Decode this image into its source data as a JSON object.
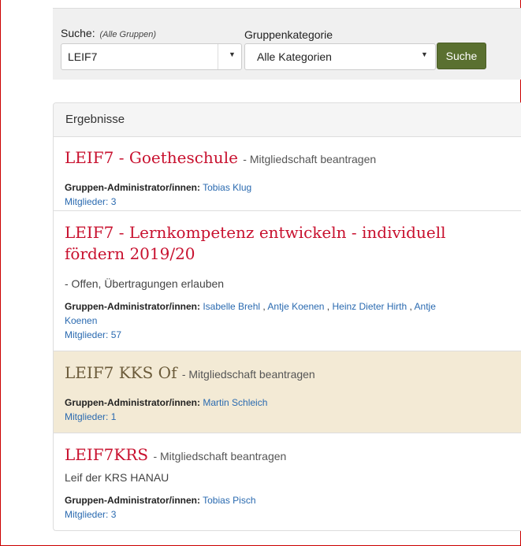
{
  "search": {
    "label": "Suche:",
    "hint": "(Alle Gruppen)",
    "value": "LEIF7",
    "category_label": "Gruppenkategorie",
    "category_value": "Alle Kategorien",
    "button": "Suche"
  },
  "results": {
    "heading": "Ergebnisse",
    "admin_label": "Gruppen-Administrator/innen:",
    "items": [
      {
        "title": "LEIF7 - Goetheschule",
        "meta": "- Mitgliedschaft beantragen",
        "admins": [
          "Tobias Klug"
        ],
        "members": "Mitglieder: 3"
      },
      {
        "title": "LEIF7 - Lernkompetenz entwickeln - individuell fördern 2019/20",
        "meta": "- Offen, Übertragungen erlauben",
        "admins": [
          "Isabelle Brehl",
          "Antje Koenen",
          "Heinz Dieter Hirth",
          "Antje Koenen"
        ],
        "members": "Mitglieder: 57"
      },
      {
        "title": "LEIF7 KKS Of",
        "meta": "- Mitgliedschaft beantragen",
        "admins": [
          "Martin Schleich"
        ],
        "members": "Mitglieder: 1"
      },
      {
        "title": "LEIF7KRS",
        "meta": "- Mitgliedschaft beantragen",
        "description": "Leif der KRS HANAU",
        "admins": [
          "Tobias Pisch"
        ],
        "members": "Mitglieder: 3"
      }
    ]
  },
  "colors": {
    "title_red": "#c8102e",
    "title_highlight": "#6b5b3a",
    "highlight_bg": "#f3ead5",
    "link_blue": "#2a6ab0",
    "button_green": "#5a7030"
  },
  "icons": [
    "caret-down-icon"
  ]
}
